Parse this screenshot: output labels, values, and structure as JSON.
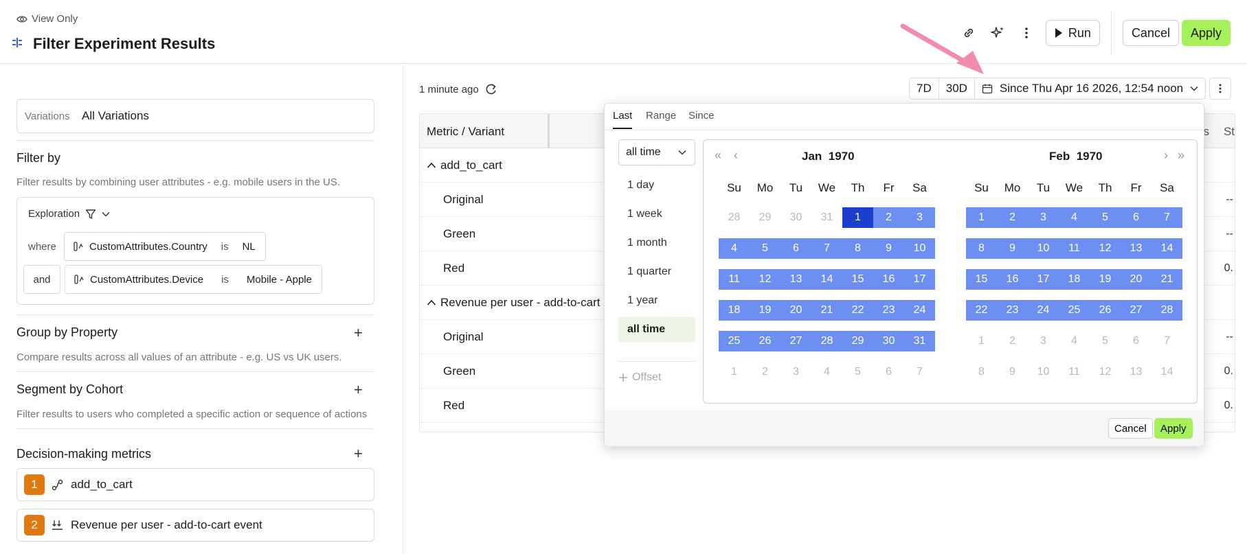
{
  "header": {
    "view_only": "View Only",
    "title": "Filter Experiment Results",
    "run_label": "Run",
    "cancel_label": "Cancel",
    "apply_label": "Apply",
    "icons": [
      "link-icon",
      "sparkle-icon",
      "kebab-icon"
    ]
  },
  "left": {
    "variations": {
      "label": "Variations",
      "value": "All Variations"
    },
    "filter_by": {
      "title": "Filter by",
      "desc": "Filter results by combining user attributes - e.g. mobile users in the US.",
      "mode": "Exploration",
      "conditions": [
        {
          "conj": "where",
          "attr": "CustomAttributes.Country",
          "op": "is",
          "value": "NL"
        },
        {
          "conj": "and",
          "attr": "CustomAttributes.Device",
          "op": "is",
          "value": "Mobile - Apple"
        }
      ]
    },
    "group_by": {
      "title": "Group by Property",
      "desc": "Compare results across all values of an attribute - e.g. US vs UK users."
    },
    "segment": {
      "title": "Segment by Cohort",
      "desc": "Filter results to users who completed a specific action or sequence of actions"
    },
    "metrics": {
      "title": "Decision-making metrics",
      "items": [
        {
          "num": "1",
          "name": "add_to_cart"
        },
        {
          "num": "2",
          "name": "Revenue per user - add-to-cart event"
        }
      ]
    }
  },
  "main": {
    "updated": "1 minute ago",
    "ranges": [
      "7D",
      "30D"
    ],
    "since_label": "Since Thu Apr 16 2026, 12:54 noon",
    "table": {
      "header_metric": "Metric / Variant",
      "header_s": "s",
      "header_st": "St",
      "groups": [
        {
          "name": "add_to_cart",
          "rows": [
            {
              "name": "Original",
              "edge": "--"
            },
            {
              "name": "Green",
              "edge": "--"
            },
            {
              "name": "Red",
              "edge": "0."
            }
          ]
        },
        {
          "name": "Revenue per user - add-to-cart",
          "rows": [
            {
              "name": "Original",
              "edge": "--"
            },
            {
              "name": "Green",
              "edge": "0."
            },
            {
              "name": "Red",
              "edge": "0."
            }
          ]
        }
      ]
    }
  },
  "popup": {
    "tabs": [
      "Last",
      "Range",
      "Since"
    ],
    "active_tab": "Last",
    "select_value": "all time",
    "presets": [
      "1 day",
      "1 week",
      "1 month",
      "1 quarter",
      "1 year",
      "all time"
    ],
    "active_preset": "all time",
    "offset_label": "Offset",
    "dow": [
      "Su",
      "Mo",
      "Tu",
      "We",
      "Th",
      "Fr",
      "Sa"
    ],
    "months": [
      {
        "month": "Jan",
        "year": "1970",
        "days": [
          28,
          29,
          30,
          31,
          1,
          2,
          3,
          4,
          5,
          6,
          7,
          8,
          9,
          10,
          11,
          12,
          13,
          14,
          15,
          16,
          17,
          18,
          19,
          20,
          21,
          22,
          23,
          24,
          25,
          26,
          27,
          28,
          29,
          30,
          31,
          1,
          2,
          3,
          4,
          5,
          6,
          7
        ],
        "in_month_from": 4,
        "in_month_to": 34
      },
      {
        "month": "Feb",
        "year": "1970",
        "days": [
          1,
          2,
          3,
          4,
          5,
          6,
          7,
          8,
          9,
          10,
          11,
          12,
          13,
          14,
          15,
          16,
          17,
          18,
          19,
          20,
          21,
          22,
          23,
          24,
          25,
          26,
          27,
          28,
          1,
          2,
          3,
          4,
          5,
          6,
          7,
          8,
          9,
          10,
          11,
          12,
          13,
          14
        ],
        "in_month_from": 0,
        "in_month_to": 27
      }
    ],
    "cancel_label": "Cancel",
    "apply_label": "Apply",
    "accent": "#6e8ff2",
    "start_color": "#1a3fcf"
  }
}
